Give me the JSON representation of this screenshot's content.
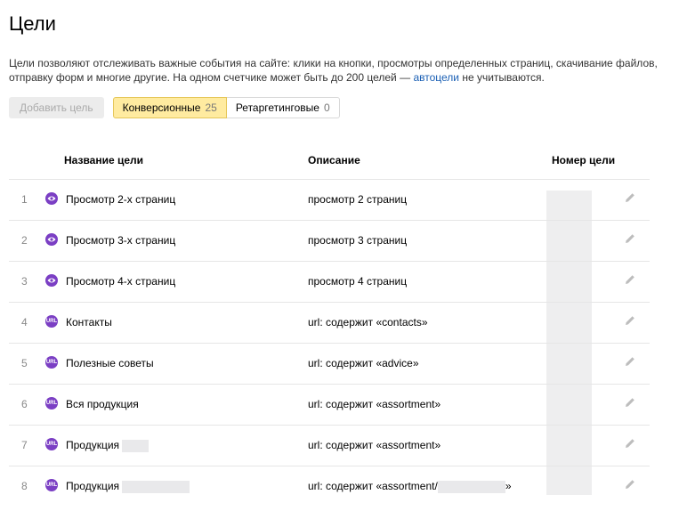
{
  "page": {
    "title": "Цели",
    "description_text": "Цели позволяют отслеживать важные события на сайте: клики на кнопки, просмотры определенных страниц, скачивание файлов, отправку форм и многие другие. На одном счетчике может быть до 200 целей — ",
    "description_link": "автоцели",
    "description_after": " не учитываются."
  },
  "toolbar": {
    "add_label": "Добавить цель",
    "tabs": [
      {
        "label": "Конверсионные",
        "count": "25"
      },
      {
        "label": "Ретаргетинговые",
        "count": "0"
      }
    ]
  },
  "table": {
    "headers": {
      "name": "Название цели",
      "description": "Описание",
      "id": "Номер цели"
    },
    "rows": [
      {
        "index": "1",
        "icon": "eye-icon",
        "name": "Просмотр 2-х страниц",
        "description": "просмотр 2 страниц"
      },
      {
        "index": "2",
        "icon": "eye-icon",
        "name": "Просмотр 3-х страниц",
        "description": "просмотр 3 страниц"
      },
      {
        "index": "3",
        "icon": "eye-icon",
        "name": "Просмотр 4-х страниц",
        "description": "просмотр 4 страниц"
      },
      {
        "index": "4",
        "icon": "url-icon",
        "icon_text": "URL",
        "name": "Контакты",
        "description": "url: содержит «contacts»"
      },
      {
        "index": "5",
        "icon": "url-icon",
        "icon_text": "URL",
        "name": "Полезные советы",
        "description": "url: содержит «advice»"
      },
      {
        "index": "6",
        "icon": "url-icon",
        "icon_text": "URL",
        "name": "Вся продукция",
        "description": "url: содержит «assortment»"
      },
      {
        "index": "7",
        "icon": "url-icon",
        "icon_text": "URL",
        "name": "Продукция",
        "description": "url: содержит «assortment»"
      },
      {
        "index": "8",
        "icon": "url-icon",
        "icon_text": "URL",
        "name": "Продукция",
        "description_prefix": "url: содержит «assortment/",
        "description_suffix": "»"
      }
    ]
  },
  "colors": {
    "accent": "#7b3fc4",
    "active_tab": "#ffeba0",
    "link": "#1a5fb4"
  }
}
